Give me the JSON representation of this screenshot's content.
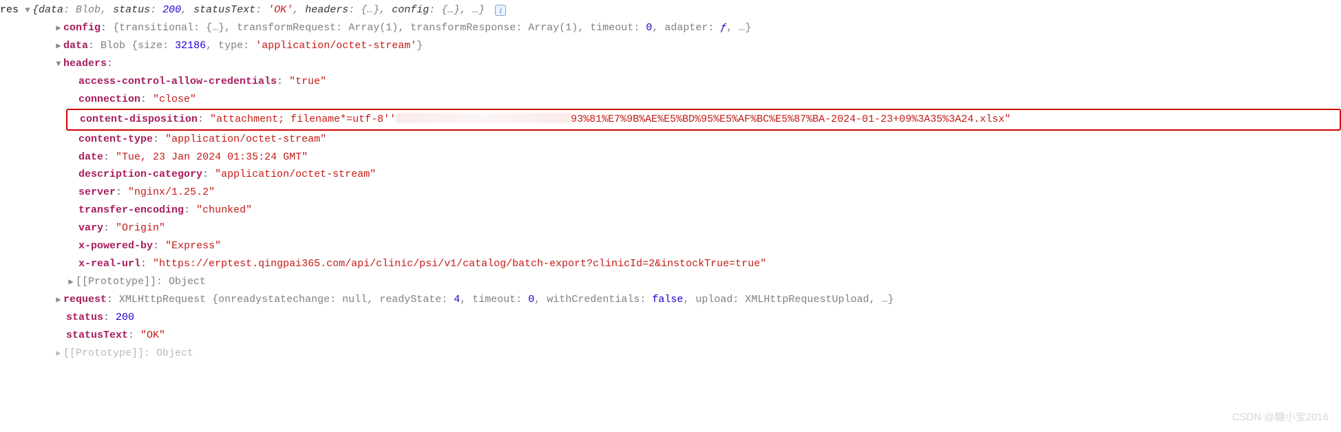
{
  "root": {
    "var": "res",
    "summary_prefix": "{data",
    "blob": "Blob",
    "status_k": "status",
    "status_v": "200",
    "st_k": "statusText",
    "st_v": "'OK'",
    "hd": "headers",
    "cf": "config",
    "ellipsis": "{…}",
    "closing": ", …}"
  },
  "config": {
    "key": "config",
    "prefix": "{",
    "t": "transitional",
    "tr": "transformRequest",
    "trv": "Array(1)",
    "trs": "transformResponse",
    "trsv": "Array(1)",
    "to": "timeout",
    "tov": "0",
    "ad": "adapter",
    "adv": "ƒ",
    "more": ", …}"
  },
  "data": {
    "key": "data",
    "blob": "Blob",
    "open": "{",
    "size": "size",
    "sizev": "32186",
    "type": "type",
    "typev": "'application/octet-stream'",
    "close": "}"
  },
  "headers": {
    "key": "headers",
    "acac": {
      "k": "access-control-allow-credentials",
      "v": "\"true\""
    },
    "conn": {
      "k": "connection",
      "v": "\"close\""
    },
    "cd": {
      "k": "content-disposition",
      "v1": "\"attachment; filename*=utf-8''",
      "v2": "93%81%E7%9B%AE%E5%BD%95%E5%AF%BC%E5%87%BA-2024-01-23+09%3A35%3A24.xlsx\""
    },
    "ct": {
      "k": "content-type",
      "v": "\"application/octet-stream\""
    },
    "date": {
      "k": "date",
      "v": "\"Tue, 23 Jan 2024 01:35:24 GMT\""
    },
    "dc": {
      "k": "description-category",
      "v": "\"application/octet-stream\""
    },
    "server": {
      "k": "server",
      "v": "\"nginx/1.25.2\""
    },
    "te": {
      "k": "transfer-encoding",
      "v": "\"chunked\""
    },
    "vary": {
      "k": "vary",
      "v": "\"Origin\""
    },
    "xpb": {
      "k": "x-powered-by",
      "v": "\"Express\""
    },
    "xru": {
      "k": "x-real-url",
      "v": "\"https://erptest.qingpai365.com/api/clinic/psi/v1/catalog/batch-export?clinicId=2&instockTrue=true\""
    },
    "proto": {
      "k": "[[Prototype]]",
      "v": "Object"
    }
  },
  "request": {
    "k": "request",
    "type": "XMLHttpRequest",
    "open": "{",
    "or": "onreadystatechange",
    "orv": "null",
    "rs": "readyState",
    "rsv": "4",
    "to": "timeout",
    "tov": "0",
    "wc": "withCredentials",
    "wcv": "false",
    "up": "upload",
    "upv": "XMLHttpRequestUpload",
    "more": ", …}"
  },
  "status": {
    "k": "status",
    "v": "200"
  },
  "statusText": {
    "k": "statusText",
    "v": "\"OK\""
  },
  "proto2": {
    "k": "[[Prototype]]",
    "v": "Object"
  },
  "icons": {
    "down": "▼",
    "right": "▶"
  },
  "watermark": "CSDN @糖小宝2016",
  "info": "i"
}
